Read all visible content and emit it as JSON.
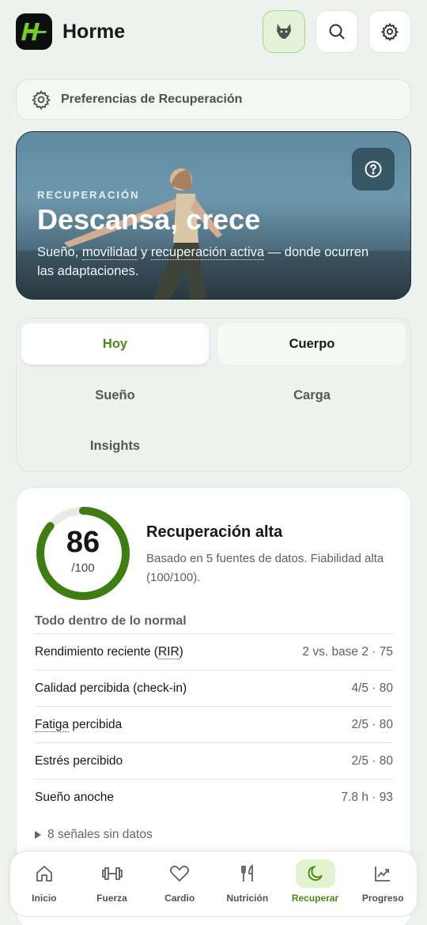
{
  "header": {
    "app_title": "Horme"
  },
  "preferences": {
    "label": "Preferencias de Recuperación"
  },
  "hero": {
    "kicker": "RECUPERACIÓN",
    "title": "Descansa, crece",
    "sub_part1": "Sueño, ",
    "sub_link1": "movilidad",
    "sub_part2": " y ",
    "sub_link2": "recuperación activa",
    "sub_part3": " — donde ocurren las adaptaciones."
  },
  "tabs": [
    {
      "label": "Hoy"
    },
    {
      "label": "Cuerpo"
    },
    {
      "label": "Sueño"
    },
    {
      "label": "Carga"
    },
    {
      "label": "Insights"
    }
  ],
  "recovery": {
    "score": "86",
    "score_max": "/100",
    "score_fraction": 0.86,
    "title": "Recuperación alta",
    "description": "Basado en 5 fuentes de datos. Fiabilidad alta (100/100).",
    "section_title": "Todo dentro de lo normal",
    "rows": [
      {
        "label_a": "Rendimiento reciente (",
        "label_b": "RIR",
        "label_c": ")",
        "value": "2 vs. base 2 · 75"
      },
      {
        "label_a": "Calidad percibida (check-in)",
        "label_b": "",
        "label_c": "",
        "value": "4/5 · 80"
      },
      {
        "label_a": "",
        "label_b": "Fatiga",
        "label_c": " percibida",
        "value": "2/5 · 80"
      },
      {
        "label_a": "Estrés percibido",
        "label_b": "",
        "label_c": "",
        "value": "2/5 · 80"
      },
      {
        "label_a": "Sueño anoche",
        "label_b": "",
        "label_c": "",
        "value": "7.8 h · 93"
      }
    ],
    "more_label": "8 señales sin datos"
  },
  "nav": [
    {
      "label": "Inicio",
      "icon": "home-icon"
    },
    {
      "label": "Fuerza",
      "icon": "dumbbell-icon"
    },
    {
      "label": "Cardio",
      "icon": "heart-icon"
    },
    {
      "label": "Nutrición",
      "icon": "fork-knife-icon"
    },
    {
      "label": "Recuperar",
      "icon": "moon-icon"
    },
    {
      "label": "Progreso",
      "icon": "chart-icon"
    }
  ],
  "colors": {
    "accent": "#4d8a10",
    "ring": "#3f7d12",
    "ring_track": "#e5ebe4"
  }
}
